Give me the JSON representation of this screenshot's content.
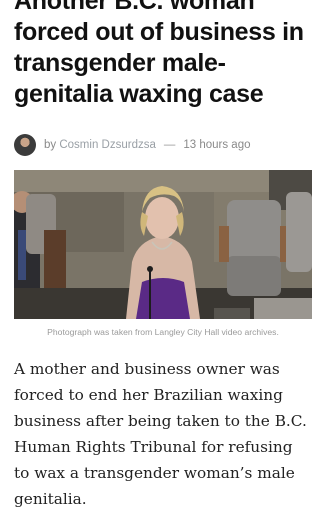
{
  "article": {
    "headline_lines": [
      "Another B.C. woman",
      "forced out of business in",
      "transgender male-",
      "genitalia waxing case"
    ],
    "byline": {
      "prefix": "by",
      "author": "Cosmin Dzsurdzsa",
      "separator": "—",
      "time": "13 hours ago"
    },
    "photo_caption": "Photograph was taken from Langley City Hall video archives.",
    "body_lines": [
      "A mother and business owner was",
      "forced to end her Brazilian waxing",
      "business after being taken to the B.C.",
      "Human Rights Tribunal for refusing",
      "to wax a transgender woman’s male",
      "genitalia."
    ]
  }
}
